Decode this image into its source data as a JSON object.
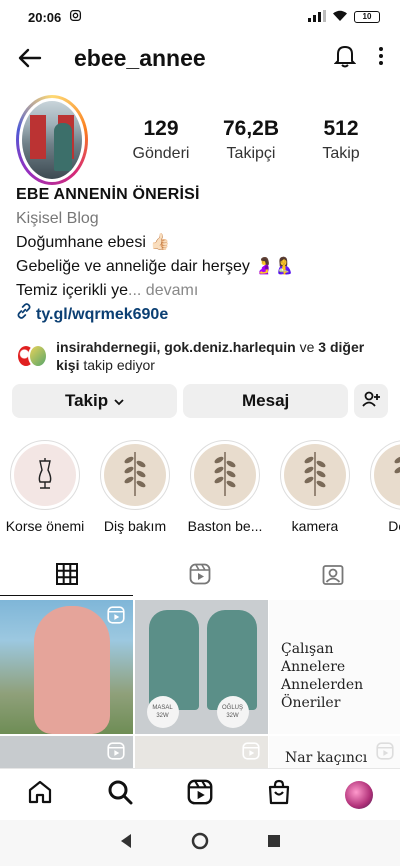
{
  "status": {
    "time": "20:06",
    "battery": "10"
  },
  "header": {
    "username": "ebee_annee"
  },
  "stats": [
    {
      "num": "129",
      "label": "Gönderi"
    },
    {
      "num": "76,2B",
      "label": "Takipçi"
    },
    {
      "num": "512",
      "label": "Takip"
    }
  ],
  "bio": {
    "name": "EBE ANNENİN ÖNERİSİ",
    "category": "Kişisel Blog",
    "line1": "Doğumhane ebesi 👍🏻",
    "line2": "Gebeliğe ve anneliğe  dair herşey 🤰🤱",
    "line3": "Temiz içerikli ye",
    "more": "... devamı",
    "link": "ty.gl/wqrmek690e"
  },
  "followers": {
    "names": "insirahdernegii, gok.deniz.harlequin",
    "connector": " ve ",
    "count": "3 diğer kişi",
    "suffix": " takip ediyor"
  },
  "buttons": {
    "follow": "Takip",
    "message": "Mesaj"
  },
  "highlights": [
    {
      "label": "Korse önemi"
    },
    {
      "label": "Diş bakım"
    },
    {
      "label": "Baston be..."
    },
    {
      "label": "kamera"
    },
    {
      "label": "Doğu"
    }
  ],
  "posts": {
    "badge_left": "MASAL 32W",
    "badge_right": "OĞLUŞ 32W",
    "post3_title": "Çalışan Annelere Annelerden Öneriler",
    "post6_title": "Nar kaçıncı"
  }
}
